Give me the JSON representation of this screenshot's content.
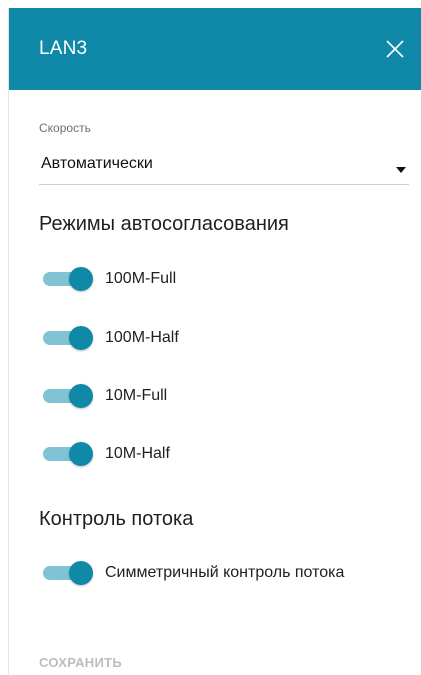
{
  "dialog": {
    "title": "LAN3",
    "close_icon": "close-icon",
    "header_color": "#1089a8"
  },
  "speed": {
    "label": "Скорость",
    "value": "Автоматически",
    "arrow_icon": "dropdown-arrow-icon"
  },
  "autoneg": {
    "title": "Режимы автосогласования",
    "modes": [
      {
        "label": "100M-Full",
        "enabled": true
      },
      {
        "label": "100M-Half",
        "enabled": true
      },
      {
        "label": "10M-Full",
        "enabled": true
      },
      {
        "label": "10M-Half",
        "enabled": true
      }
    ]
  },
  "flow_control": {
    "title": "Контроль потока",
    "symmetric": {
      "label": "Симметричный контроль потока",
      "enabled": true
    }
  },
  "footer": {
    "save_label": "СОХРАНИТЬ",
    "save_enabled": false
  },
  "colors": {
    "accent": "#1089a8",
    "toggle_track_on": "#7fc3d5",
    "disabled_text": "#bdbdbd"
  }
}
